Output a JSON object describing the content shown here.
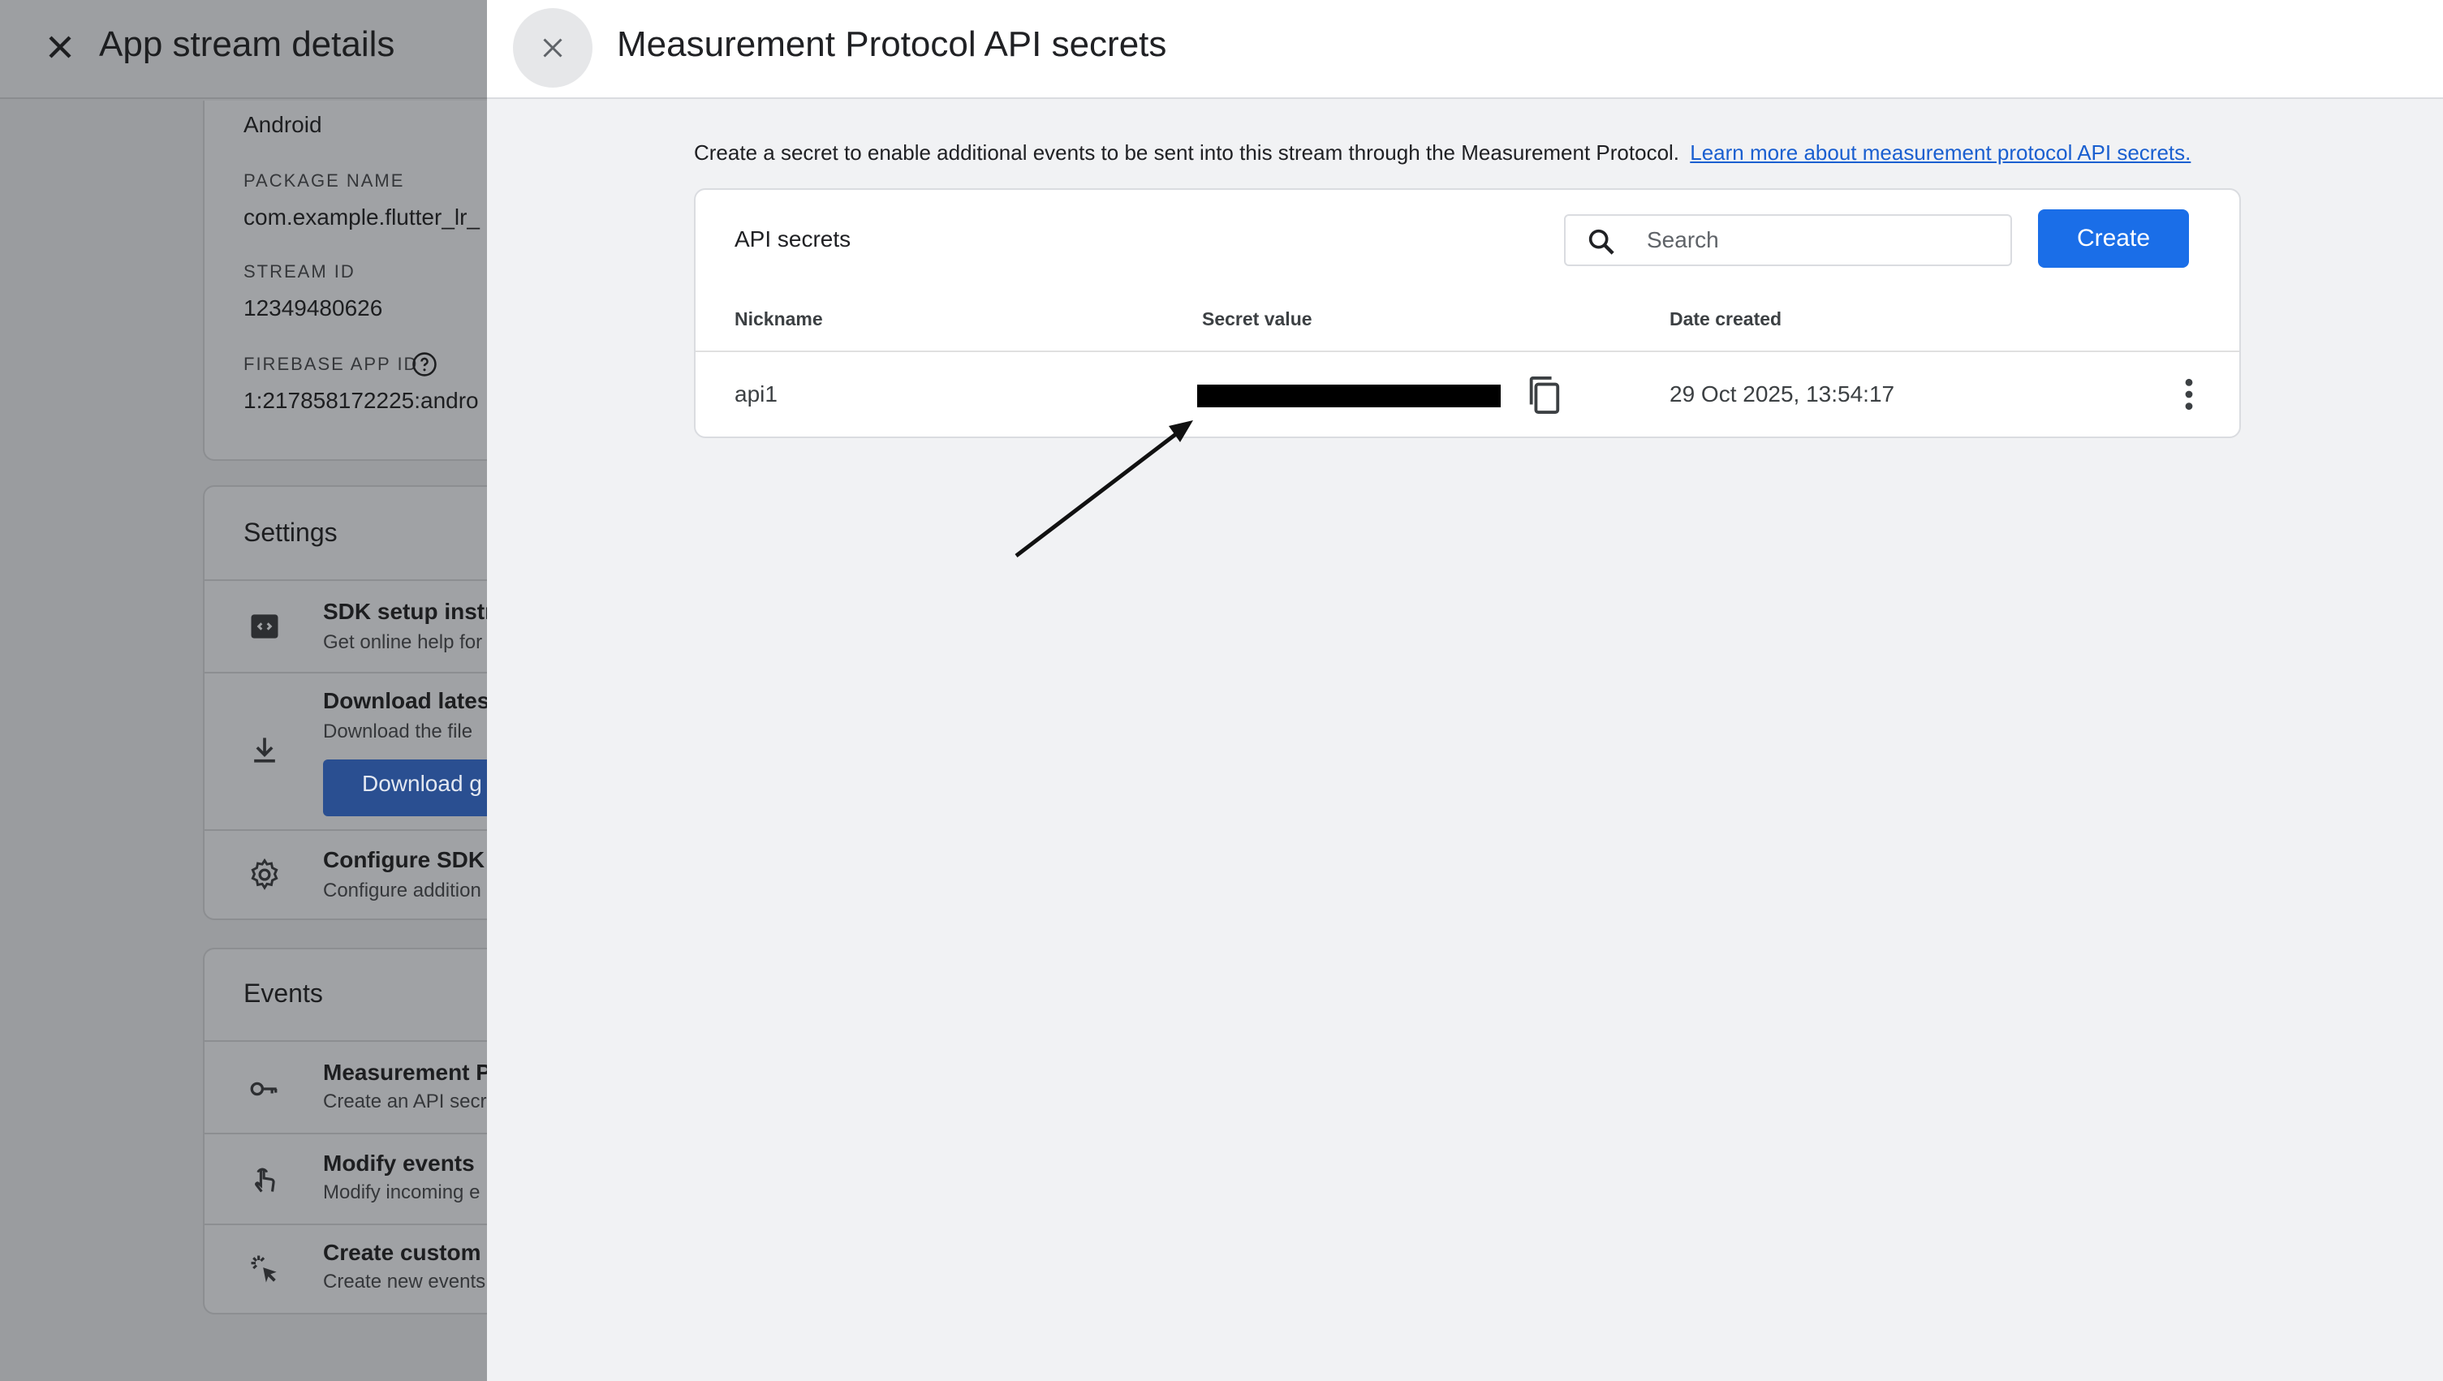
{
  "background": {
    "title": "App stream details",
    "platform": "Android",
    "package_name_label": "PACKAGE NAME",
    "package_name_value": "com.example.flutter_lr_",
    "stream_id_label": "STREAM ID",
    "stream_id_value": "12349480626",
    "firebase_label": "FIREBASE APP ID",
    "firebase_value": "1:217858172225:andro",
    "settings": {
      "title": "Settings",
      "rows": [
        {
          "title": "SDK setup instr",
          "sub": "Get online help for"
        },
        {
          "title": "Download latest",
          "sub": "Download the file",
          "button": "Download g"
        },
        {
          "title": "Configure SDK s",
          "sub": "Configure addition"
        }
      ]
    },
    "events": {
      "title": "Events",
      "rows": [
        {
          "title": "Measurement P",
          "sub": "Create an API secr"
        },
        {
          "title": "Modify events",
          "sub": "Modify incoming e"
        },
        {
          "title": "Create custom e",
          "sub": "Create new events"
        }
      ]
    }
  },
  "drawer": {
    "title": "Measurement Protocol API secrets",
    "intro": "Create a secret to enable additional events to be sent into this stream through the Measurement Protocol.",
    "learn_more": "Learn more about measurement protocol API secrets.",
    "card": {
      "title": "API secrets",
      "search_placeholder": "Search",
      "create_label": "Create",
      "columns": [
        "Nickname",
        "Secret value",
        "Date created"
      ],
      "rows": [
        {
          "nickname": "api1",
          "date_created": "29 Oct 2025, 13:54:17"
        }
      ]
    }
  },
  "colors": {
    "primary": "#1a6ee8",
    "link": "#1a5fd0",
    "overlay": "#9a9c9f"
  },
  "icons": [
    "close-icon",
    "help-icon",
    "code-icon",
    "download-icon",
    "gear-icon",
    "key-icon",
    "touch-icon",
    "sparkle-cursor-icon",
    "search-icon",
    "copy-icon",
    "more-vert-icon"
  ]
}
